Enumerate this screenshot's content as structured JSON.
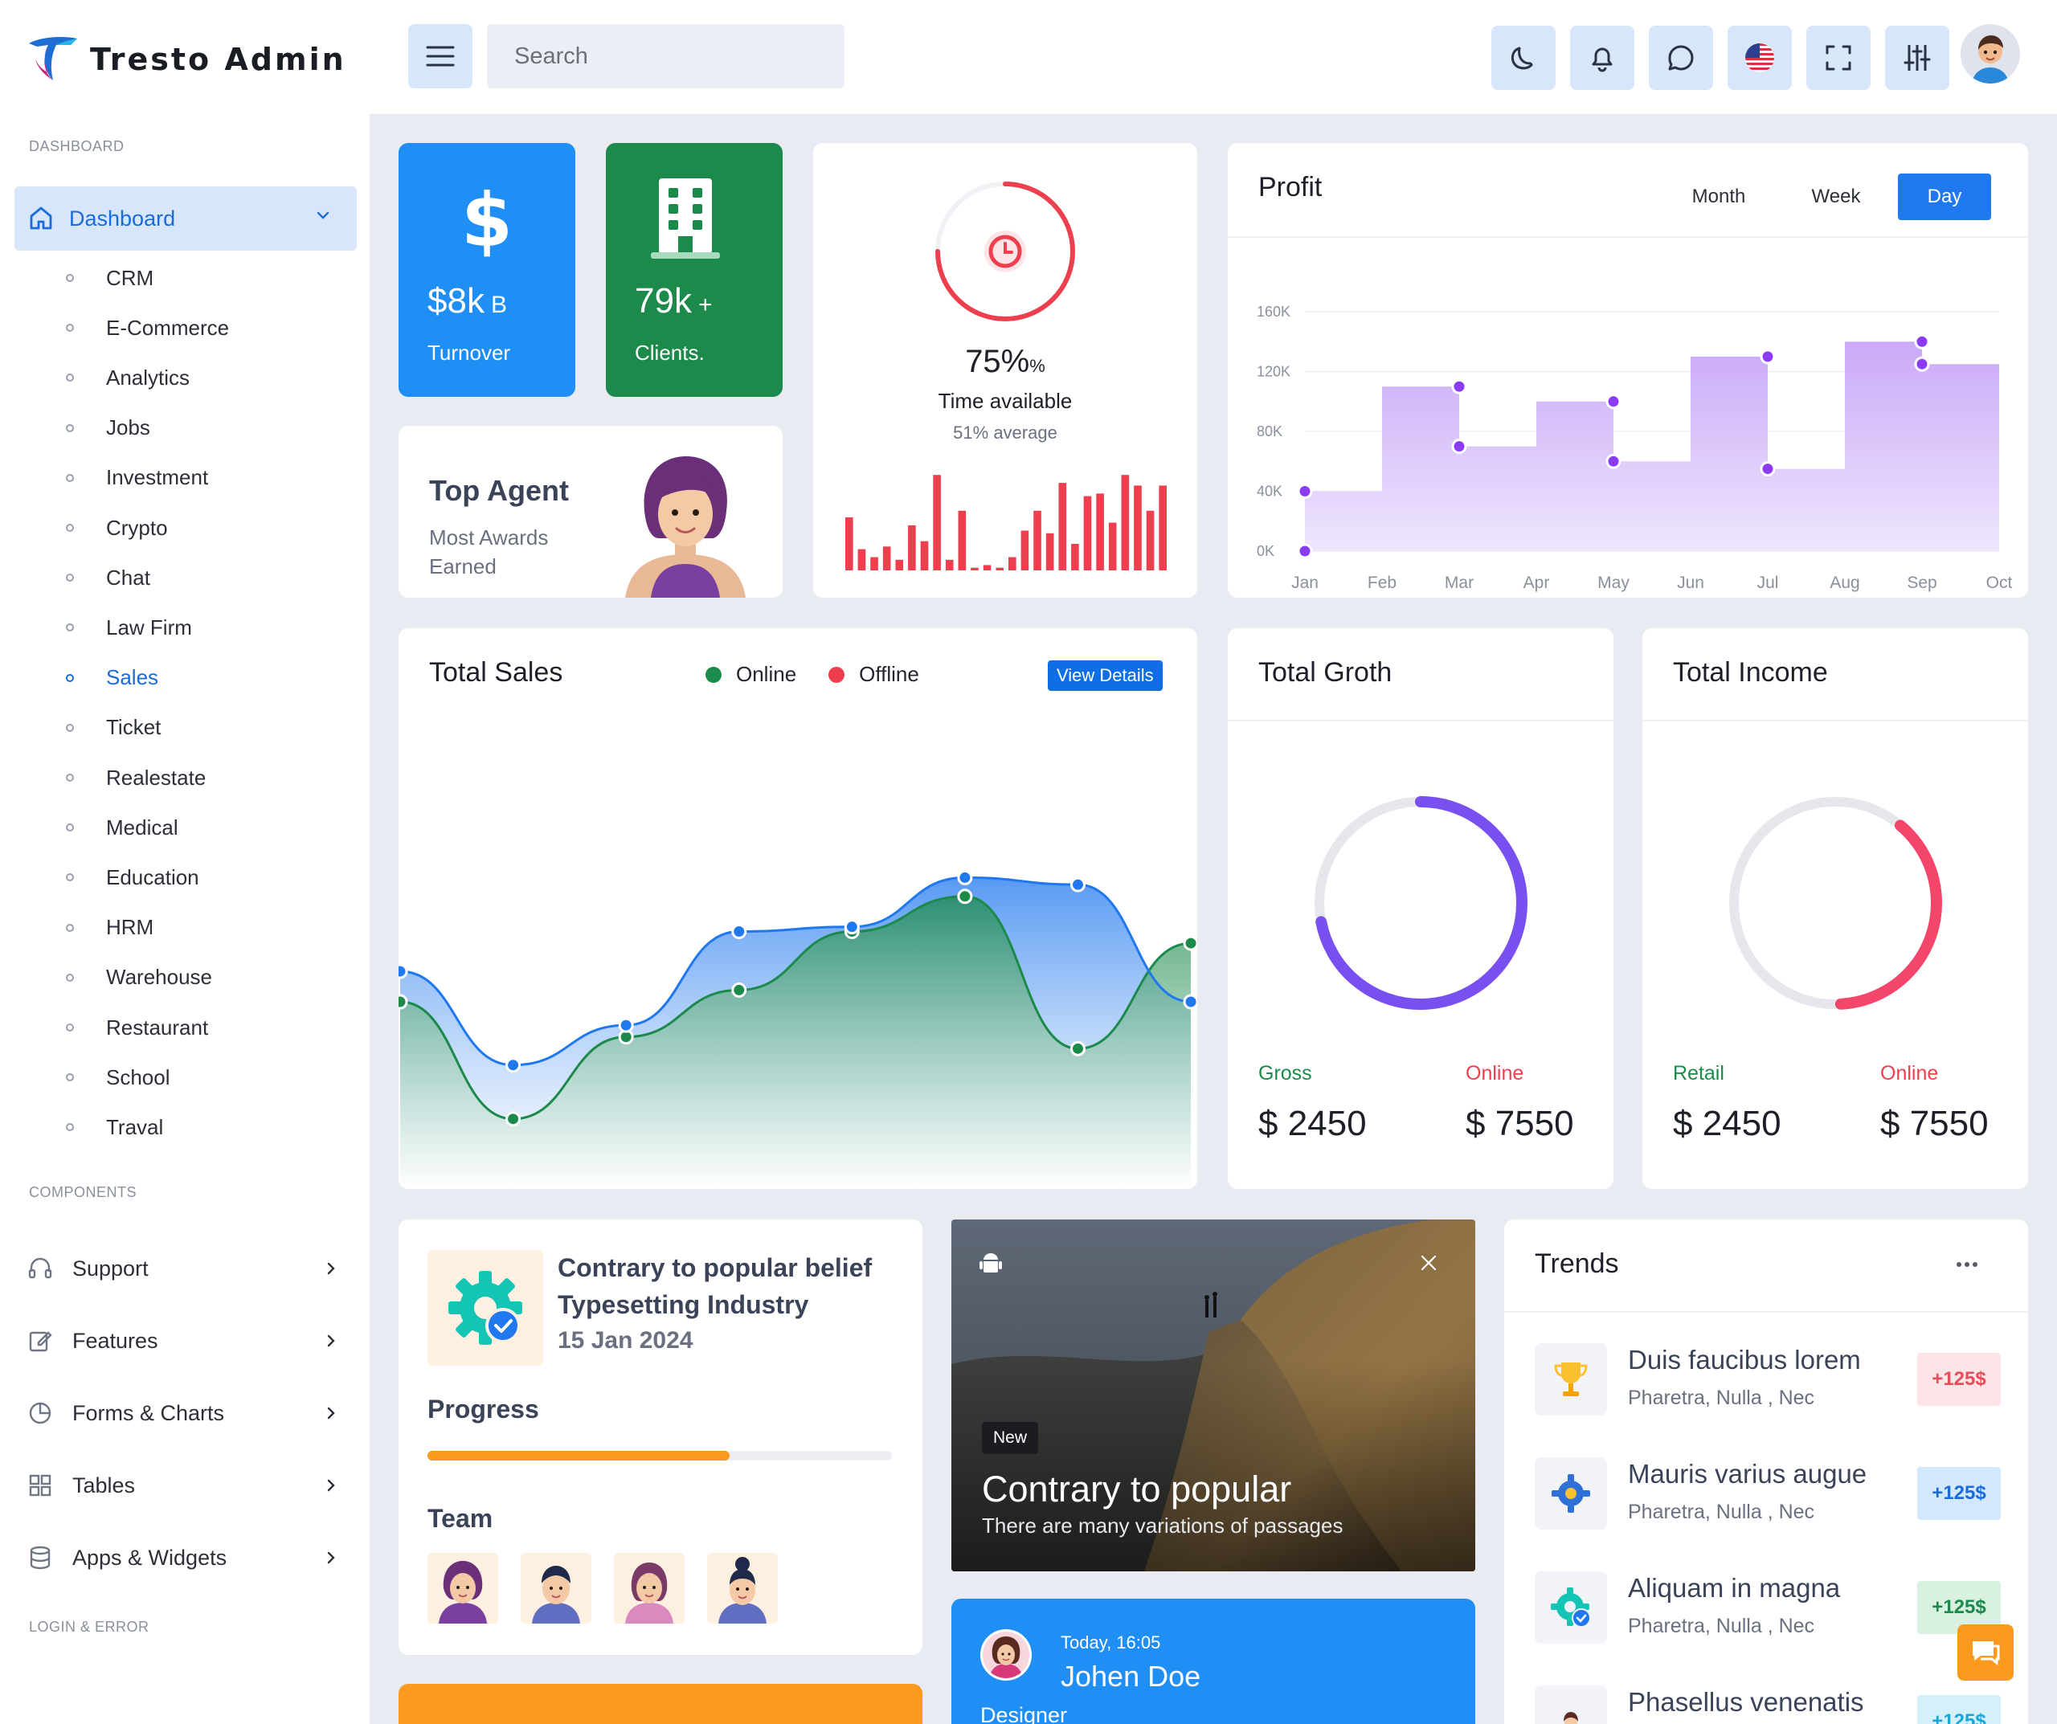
{
  "app": {
    "name": "Tresto Admin"
  },
  "search": {
    "placeholder": "Search"
  },
  "sidebar": {
    "dashboard_heading": "DASHBOARD",
    "active_label": "Dashboard",
    "sub_items": [
      "CRM",
      "E-Commerce",
      "Analytics",
      "Jobs",
      "Investment",
      "Crypto",
      "Chat",
      "Law Firm",
      "Sales",
      "Ticket",
      "Realestate",
      "Medical",
      "Education",
      "HRM",
      "Warehouse",
      "Restaurant",
      "School",
      "Traval"
    ],
    "active_sub": "Sales",
    "components_heading": "COMPONENTS",
    "components": [
      "Support",
      "Features",
      "Forms & Charts",
      "Tables",
      "Apps & Widgets"
    ],
    "login_heading": "LOGIN & ERROR"
  },
  "stats": {
    "turnover": {
      "value": "$8k",
      "suffix": "B",
      "label": "Turnover",
      "color": "#1f8ff5"
    },
    "clients": {
      "value": "79k",
      "suffix": "+",
      "label": "Clients.",
      "color": "#1b8a4b"
    }
  },
  "top_agent": {
    "title": "Top Agent",
    "line1": "Most Awards",
    "line2": "Earned"
  },
  "time_card": {
    "percent": "75%",
    "percent_unit": "%",
    "label": "Time available",
    "sub": "51% average",
    "progress": 0.75
  },
  "profit": {
    "title": "Profit",
    "tabs": [
      "Month",
      "Week",
      "Day"
    ],
    "active_tab": "Day"
  },
  "total_sales": {
    "title": "Total Sales",
    "legend_online": "Online",
    "legend_offline": "Offline",
    "button": "View Details"
  },
  "total_growth": {
    "title": "Total Groth",
    "left_label": "Gross",
    "left_value": "$ 2450",
    "right_label": "Online",
    "right_value": "$ 7550",
    "progress": 0.72
  },
  "total_income": {
    "title": "Total Income",
    "left_label": "Retail",
    "left_value": "$ 2450",
    "right_label": "Online",
    "right_value": "$ 7550",
    "progress": 0.38
  },
  "project": {
    "title_line1": "Contrary to popular belief",
    "title_line2": "Typesetting Industry",
    "date": "15 Jan 2024",
    "progress_label": "Progress",
    "progress": 0.65,
    "team_label": "Team"
  },
  "photo_card": {
    "badge": "New",
    "title": "Contrary to popular",
    "subtitle": "There are many variations of passages"
  },
  "profile_card": {
    "time": "Today, 16:05",
    "name": "Johen Doe",
    "role": "Designer"
  },
  "trends": {
    "title": "Trends",
    "items": [
      {
        "title": "Duis faucibus lorem",
        "sub": "Pharetra, Nulla , Nec",
        "badge": "+125$",
        "icon": "trophy-icon",
        "badge_bg": "#fde4e6",
        "badge_fg": "#e64c5b"
      },
      {
        "title": "Mauris varius augue",
        "sub": "Pharetra, Nulla , Nec",
        "badge": "+125$",
        "icon": "settings-icon",
        "badge_bg": "#d3e8fc",
        "badge_fg": "#1a6cd8"
      },
      {
        "title": "Aliquam in magna",
        "sub": "Pharetra, Nulla , Nec",
        "badge": "+125$",
        "icon": "badge-check-icon",
        "badge_bg": "#d9f1e1",
        "badge_fg": "#1b8a4b"
      },
      {
        "title": "Phasellus venenatis",
        "sub": "",
        "badge": "+125$",
        "icon": "person-icon",
        "badge_bg": "#d3f0fb",
        "badge_fg": "#1aa6d8"
      }
    ]
  },
  "chart_data": [
    {
      "type": "area",
      "title": "Profit",
      "categories": [
        "Jan",
        "Feb",
        "Mar",
        "Apr",
        "May",
        "Jun",
        "Jul",
        "Aug",
        "Sep",
        "Oct"
      ],
      "values": [
        0,
        40,
        110,
        70,
        100,
        60,
        130,
        55,
        140,
        125
      ],
      "yticks": [
        "0K",
        "40K",
        "80K",
        "120K",
        "160K"
      ],
      "ylim": [
        0,
        160
      ],
      "step": true,
      "color": "#8b3cf0"
    },
    {
      "type": "area",
      "title": "Total Sales",
      "x": [
        0,
        1,
        2,
        3,
        4,
        5,
        6,
        7
      ],
      "series": [
        {
          "name": "Online",
          "values": [
            30,
            -20,
            15,
            35,
            60,
            75,
            10,
            55
          ],
          "color": "#1b8a4b"
        },
        {
          "name": "Offline",
          "values": [
            43,
            3,
            20,
            60,
            62,
            83,
            80,
            30
          ],
          "color": "#1f78ee"
        }
      ]
    },
    {
      "type": "bar",
      "title": "Time available",
      "values": [
        40,
        16,
        10,
        18,
        8,
        34,
        22,
        72,
        8,
        45,
        2,
        4,
        2,
        10,
        30,
        45,
        28,
        66,
        20,
        56,
        58,
        36,
        72,
        64,
        45,
        64
      ]
    }
  ]
}
